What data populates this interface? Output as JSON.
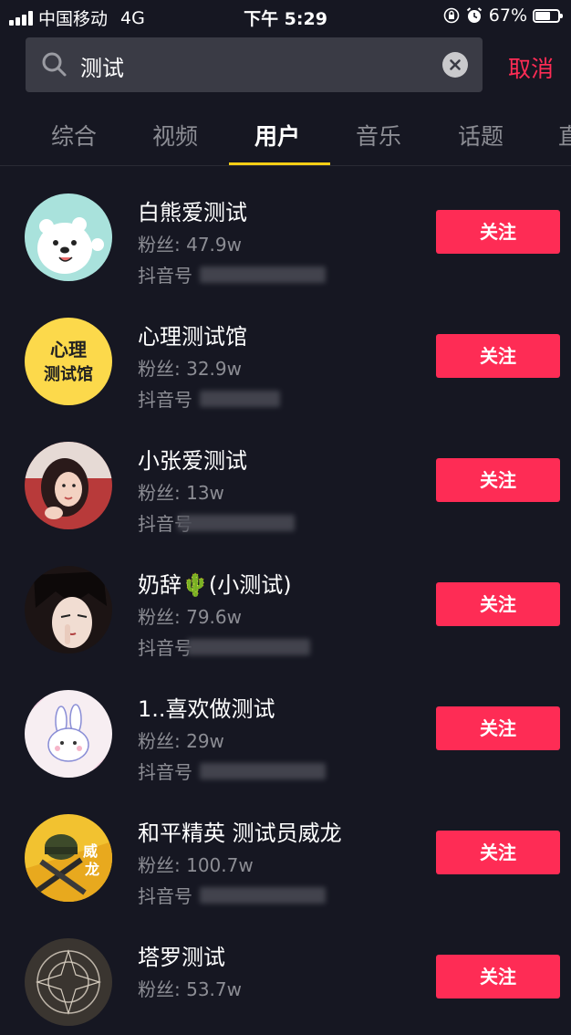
{
  "status_bar": {
    "carrier": "中国移动",
    "network": "4G",
    "time": "下午 5:29",
    "battery": "67%",
    "battery_level": 0.67
  },
  "search": {
    "query": "测试",
    "cancel_label": "取消"
  },
  "tabs": [
    {
      "label": "综合"
    },
    {
      "label": "视频"
    },
    {
      "label": "用户"
    },
    {
      "label": "音乐"
    },
    {
      "label": "话题"
    },
    {
      "label": "直"
    }
  ],
  "active_tab": "用户",
  "users": [
    {
      "name": "白熊爱测试",
      "fans": "粉丝: 47.9w",
      "id_label": "抖音号",
      "follow_label": "关注",
      "avatar": "white-bear-avatar"
    },
    {
      "name": "心理测试馆",
      "fans": "粉丝: 32.9w",
      "id_label": "抖音号",
      "follow_label": "关注",
      "avatar": "yellow-text-avatar",
      "avatar_text_1": "心理",
      "avatar_text_2": "测试馆"
    },
    {
      "name": "小张爱测试",
      "fans": "粉丝: 13w",
      "id_label": "抖音号",
      "follow_label": "关注",
      "avatar": "girl-photo-avatar"
    },
    {
      "name": "奶辞🌵(小测试)",
      "fans": "粉丝: 79.6w",
      "id_label": "抖音号",
      "follow_label": "关注",
      "avatar": "anime-boy-avatar"
    },
    {
      "name": "1..喜欢做测试",
      "fans": "粉丝: 29w",
      "id_label": "抖音号",
      "follow_label": "关注",
      "avatar": "bunny-avatar"
    },
    {
      "name": "和平精英 测试员威龙",
      "fans": "粉丝: 100.7w",
      "id_label": "抖音号",
      "follow_label": "关注",
      "avatar": "game-helmet-avatar",
      "avatar_text_1": "威",
      "avatar_text_2": "龙"
    },
    {
      "name": "塔罗测试",
      "fans": "粉丝: 53.7w",
      "id_label": "抖音号",
      "follow_label": "关注",
      "avatar": "tarot-avatar"
    }
  ],
  "colors": {
    "background": "#161722",
    "accent": "#fe2c55",
    "tab_indicator": "#face15",
    "secondary_text": "#8c8d94"
  }
}
